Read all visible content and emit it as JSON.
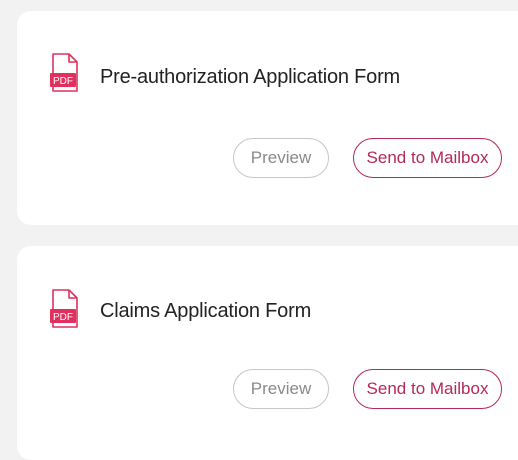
{
  "documents": [
    {
      "icon": "pdf-file-icon",
      "icon_label": "PDF",
      "title": "Pre-authorization Application Form",
      "preview_label": "Preview",
      "send_label": "Send to Mailbox"
    },
    {
      "icon": "pdf-file-icon",
      "icon_label": "PDF",
      "title": "Claims Application Form",
      "preview_label": "Preview",
      "send_label": "Send to Mailbox"
    }
  ],
  "colors": {
    "background": "#f2f2f2",
    "card": "#ffffff",
    "accent": "#b5285a",
    "pdf_icon": "#e0305e",
    "preview_text": "#8a8a8a",
    "preview_border": "#c6c6c6",
    "title_text": "#222222"
  }
}
